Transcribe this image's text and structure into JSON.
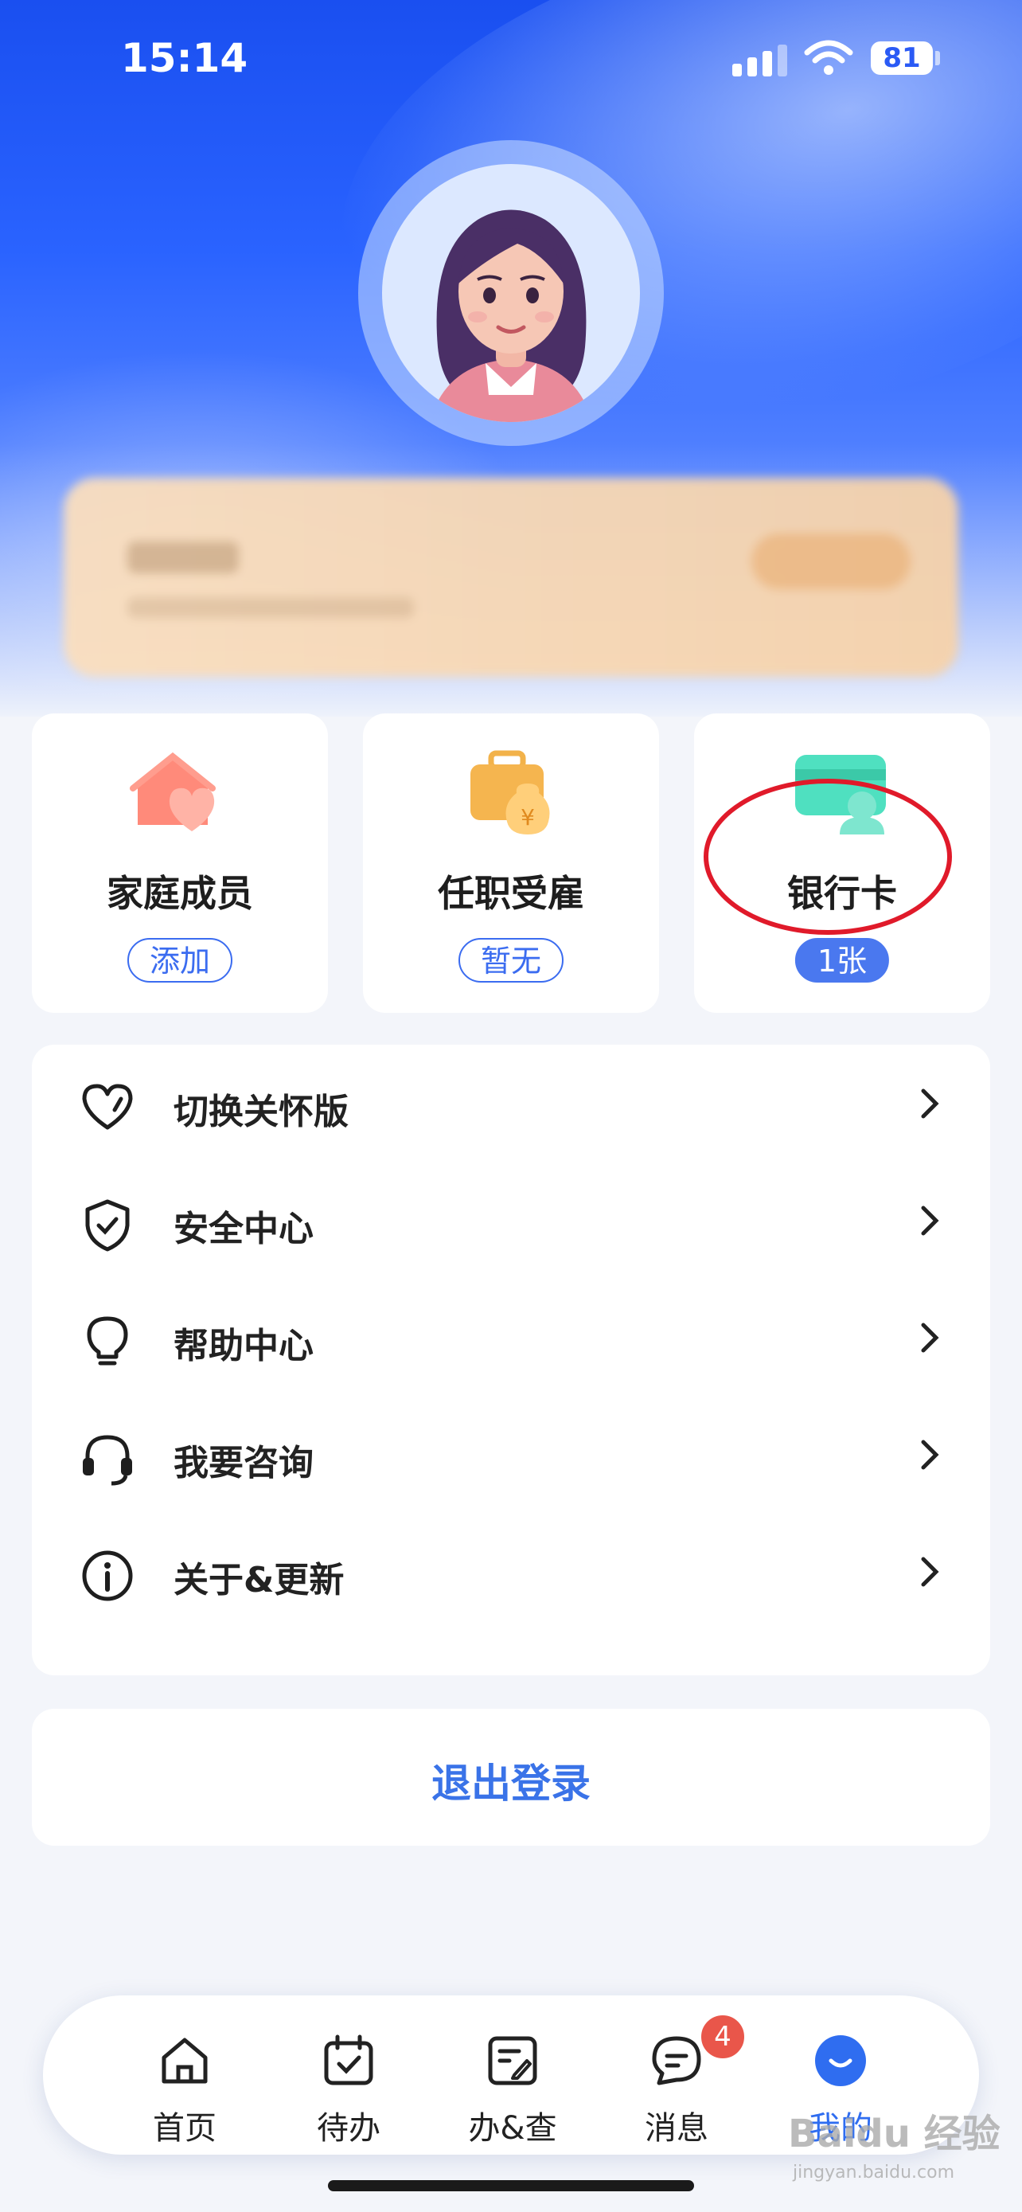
{
  "status_bar": {
    "time": "15:14",
    "battery": "81"
  },
  "quick_cards": [
    {
      "label": "家庭成员",
      "badge": "添加"
    },
    {
      "label": "任职受雇",
      "badge": "暂无"
    },
    {
      "label": "银行卡",
      "badge": "1张"
    }
  ],
  "menu": [
    {
      "label": "切换关怀版",
      "icon": "heart-icon"
    },
    {
      "label": "安全中心",
      "icon": "shield-check-icon"
    },
    {
      "label": "帮助中心",
      "icon": "lightbulb-icon"
    },
    {
      "label": "我要咨询",
      "icon": "headset-icon"
    },
    {
      "label": "关于&更新",
      "icon": "info-icon"
    }
  ],
  "logout_label": "退出登录",
  "tabs": [
    {
      "label": "首页",
      "icon": "home-icon"
    },
    {
      "label": "待办",
      "icon": "calendar-check-icon"
    },
    {
      "label": "办&查",
      "icon": "edit-doc-icon"
    },
    {
      "label": "消息",
      "icon": "chat-icon",
      "badge": "4"
    },
    {
      "label": "我的",
      "icon": "profile-smile-icon",
      "active": true
    }
  ],
  "watermark": {
    "brand": "Baidu 经验",
    "url": "jingyan.baidu.com"
  },
  "colors": {
    "primary": "#2f6df0",
    "badge_red": "#e9564a",
    "highlight_ring": "#e01a2a"
  }
}
